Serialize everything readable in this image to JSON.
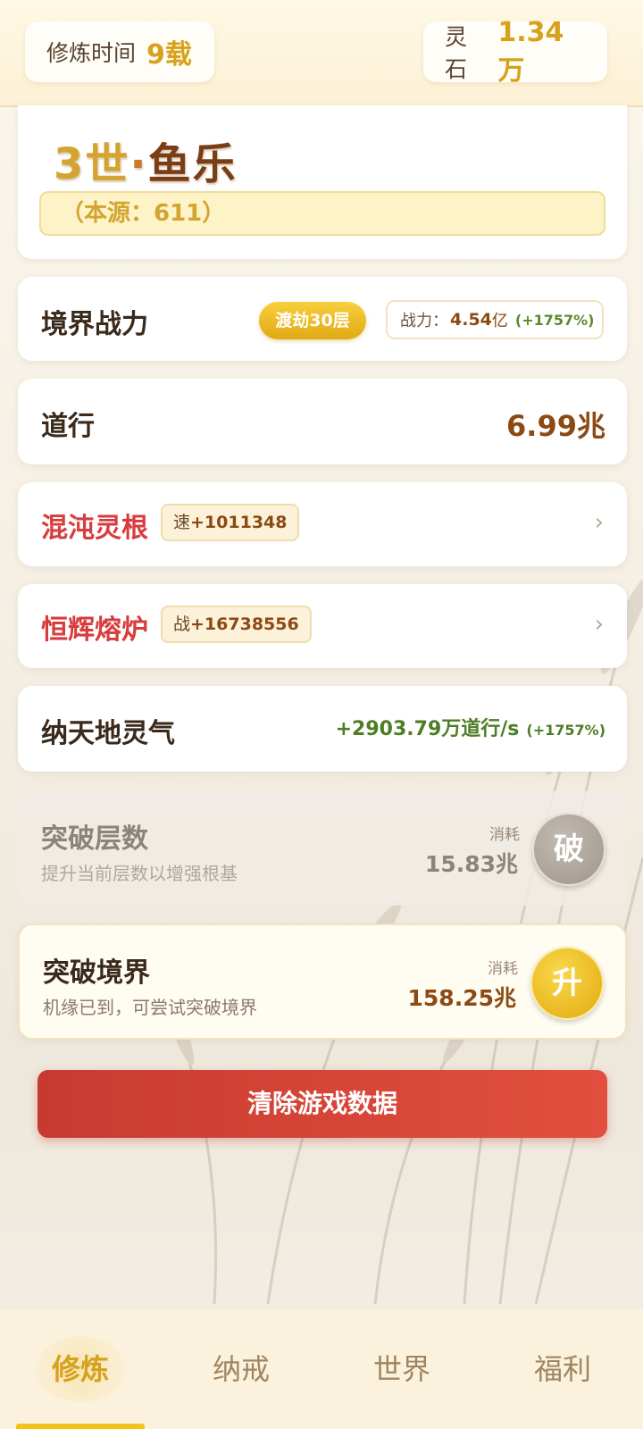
{
  "header": {
    "cultivation_time_label": "修炼时间",
    "cultivation_time_value": "9载",
    "spirit_stone_label": "灵石",
    "spirit_stone_value": "1.34万"
  },
  "character": {
    "generation": "3世",
    "separator": "·",
    "name": "鱼乐",
    "origin": "（本源：611）"
  },
  "realm": {
    "label": "境界战力",
    "badge": "渡劫30层",
    "power_label": "战力：",
    "power_value": "4.54",
    "power_unit": "亿",
    "power_percent": "(+1757%)"
  },
  "dao": {
    "label": "道行",
    "value": "6.99兆"
  },
  "spirit_root": {
    "label": "混沌灵根",
    "chip_prefix": "速",
    "chip_value": "+1011348"
  },
  "furnace": {
    "label": "恒辉熔炉",
    "chip_prefix": "战",
    "chip_value": "+16738556"
  },
  "absorb": {
    "label": "纳天地灵气",
    "value": "+2903.79万道行/s",
    "percent": "(+1757%)"
  },
  "layer_breakthrough": {
    "title": "突破层数",
    "subtitle": "提升当前层数以增强根基",
    "cost_label": "消耗",
    "cost_value": "15.83兆",
    "button": "破"
  },
  "realm_breakthrough": {
    "title": "突破境界",
    "subtitle": "机缘已到，可尝试突破境界",
    "cost_label": "消耗",
    "cost_value": "158.25兆",
    "button": "升"
  },
  "clear_button": "清除游戏数据",
  "nav": {
    "items": [
      "修炼",
      "纳戒",
      "世界",
      "福利"
    ],
    "active_index": 0
  },
  "colors": {
    "accent_gold": "#d7a21b",
    "danger_red": "#d83c3c",
    "growth_green": "#4e7d26",
    "brown": "#8b4a14"
  }
}
